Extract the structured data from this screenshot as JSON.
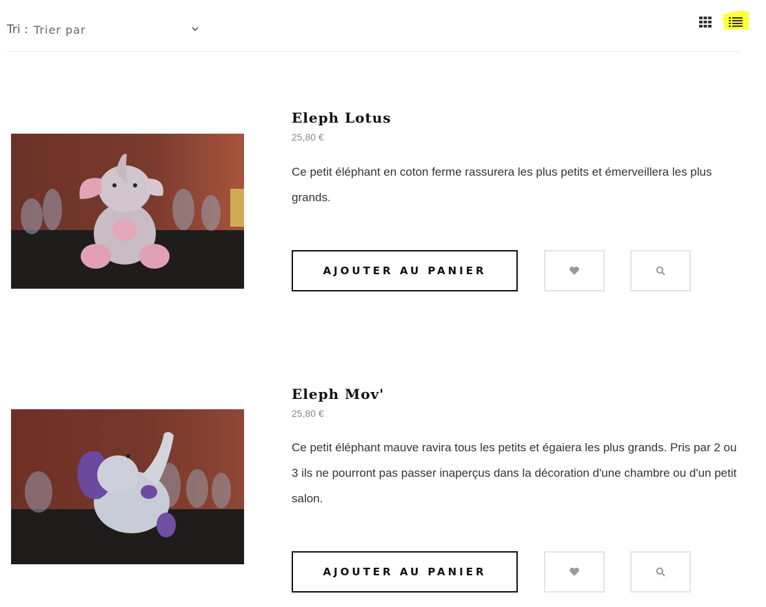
{
  "toolbar": {
    "sort_label": "Tri :",
    "sort_value": "Trier par",
    "view_grid_icon": "grid-view-icon",
    "view_list_icon": "list-view-icon",
    "active_view": "list",
    "highlight_color": "#ffff3a"
  },
  "products": [
    {
      "title": "Eleph Lotus",
      "price": "25,80 €",
      "description": "Ce petit éléphant en coton ferme rassurera les plus petits et émerveillera les plus grands.",
      "cart_label": "AJOUTER AU PANIER",
      "wishlist_icon": "heart-icon",
      "quickview_icon": "search-icon"
    },
    {
      "title": "Eleph Mov'",
      "price": "25,80 €",
      "description": "Ce petit éléphant mauve ravira tous les petits et égaiera les plus grands. Pris par 2 ou 3 ils ne pourront pas passer inaperçus dans la décoration d'une chambre ou d'un petit salon.",
      "cart_label": "AJOUTER AU PANIER",
      "wishlist_icon": "heart-icon",
      "quickview_icon": "search-icon"
    }
  ]
}
